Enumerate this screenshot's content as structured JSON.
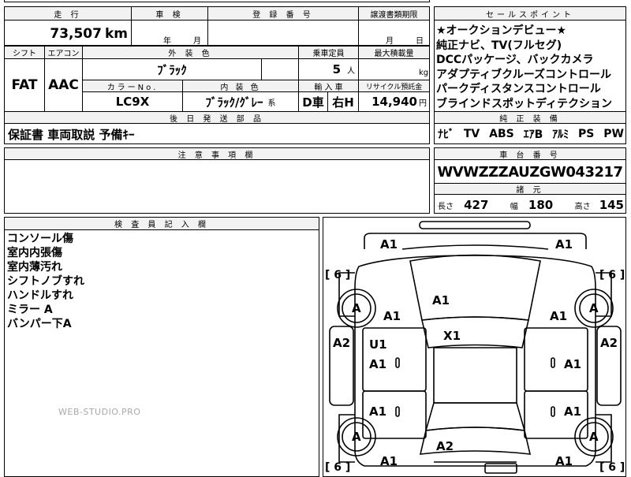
{
  "mileage": {
    "header": "走 行",
    "value": "73,507",
    "unit": "km"
  },
  "inspection": {
    "header": "車 検",
    "year_label": "年",
    "month_label": "月"
  },
  "registration": {
    "header": "登 録 番 号"
  },
  "transfer_deadline": {
    "header": "譲渡書類期限",
    "month_label": "月",
    "day_label": "日"
  },
  "sales_points": {
    "header": "セールスポイント",
    "lines": [
      "★オークションデビュー★",
      "純正ナビ、TV(フルセグ)",
      "DCCパッケージ、バックカメラ",
      "アダプティブクルーズコントロール",
      "パークディスタンスコントロール",
      "ブラインドスポットディテクション"
    ]
  },
  "shift": {
    "header": "シフト",
    "value": "FAT"
  },
  "aircon": {
    "header": "エアコン",
    "value": "AAC"
  },
  "exterior_color": {
    "header": "外 装 色",
    "value": "ﾌﾞﾗｯｸ"
  },
  "capacity": {
    "header": "乗車定員",
    "value": "5",
    "unit": "人"
  },
  "max_load": {
    "header": "最大積載量",
    "unit": "kg"
  },
  "color_no": {
    "header": "カラーNo.",
    "value": "LC9X"
  },
  "interior_color": {
    "header": "内 装 色",
    "value": "ﾌﾞﾗｯｸ/ｸﾞﾚｰ",
    "suffix": "系"
  },
  "import": {
    "header": "輸 入 車",
    "type": "D車",
    "handle": "右H"
  },
  "recycle": {
    "header": "リサイクル預託金",
    "value": "14,940",
    "unit": "円"
  },
  "later_parts": {
    "header": "後 日 発 送 部 品",
    "value": "保証書 車両取説 予備ｷｰ"
  },
  "genuine_equipment": {
    "header": "純 正 装 備",
    "items": [
      "ﾅﾋﾞ",
      "TV",
      "ABS",
      "ｴｱB",
      "ｱﾙﾐ",
      "PS",
      "PW"
    ]
  },
  "notes": {
    "header": "注 意 事 項 欄"
  },
  "chassis": {
    "header": "車 台 番 号",
    "value": "WVWZZZAUZGW043217"
  },
  "specs": {
    "header": "諸 元",
    "length_label": "長さ",
    "length": "427",
    "width_label": "幅",
    "width": "180",
    "height_label": "高さ",
    "height": "145"
  },
  "inspector_notes": {
    "header": "検 査 員 記 入 欄",
    "lines": [
      "コンソール傷",
      "室内内張傷",
      "室内薄汚れ",
      "シフトノブすれ",
      "ハンドルすれ",
      "ミラー A",
      "バンパー下A"
    ]
  },
  "watermark": "WEB-STUDIO.PRO",
  "diagram": {
    "labels": {
      "front_left": "A1",
      "front_right": "A1",
      "hood": "A1",
      "left_front_fender": "A1",
      "right_front_fender": "A1",
      "left_side_outer": "A2",
      "right_side_outer": "A2",
      "left_front_door_top": "U1",
      "left_front_door": "A1",
      "left_rear_door": "A1",
      "right_front_door": "A1",
      "right_rear_door": "A1",
      "roof": "X1",
      "trunk": "A2",
      "rear_left": "A1",
      "rear_right": "A1",
      "wheel_fl": "A",
      "wheel_fr": "A",
      "wheel_rl": "A",
      "wheel_rr": "A",
      "bracket_tl": "[ 6 ]",
      "bracket_tr": "[ 6 ]",
      "bracket_bl": "[ 6 ]",
      "bracket_br": "[ 6 ]"
    }
  }
}
